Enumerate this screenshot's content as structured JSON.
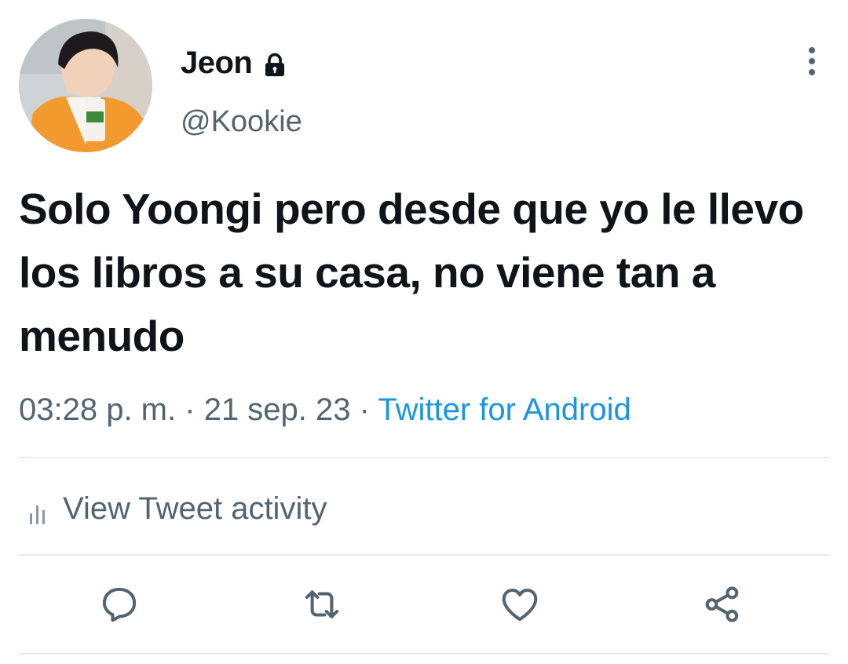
{
  "tweet": {
    "author": {
      "display_name": "Jeon",
      "handle": "@Kookie",
      "protected_icon": "lock-icon",
      "avatar": "profile-photo"
    },
    "text": "Solo Yoongi pero desde que yo le llevo los libros a su casa, no viene tan a menudo",
    "time": "03:28 p. m.",
    "separator": "·",
    "date": "21 sep. 23",
    "source": "Twitter for Android",
    "activity_label": "View Tweet activity",
    "actions": [
      "reply-icon",
      "retweet-icon",
      "like-icon",
      "share-icon"
    ]
  },
  "colors": {
    "text": "#0f1419",
    "secondary": "#536471",
    "link": "#1b95e0",
    "divider": "#e6ecf0"
  }
}
